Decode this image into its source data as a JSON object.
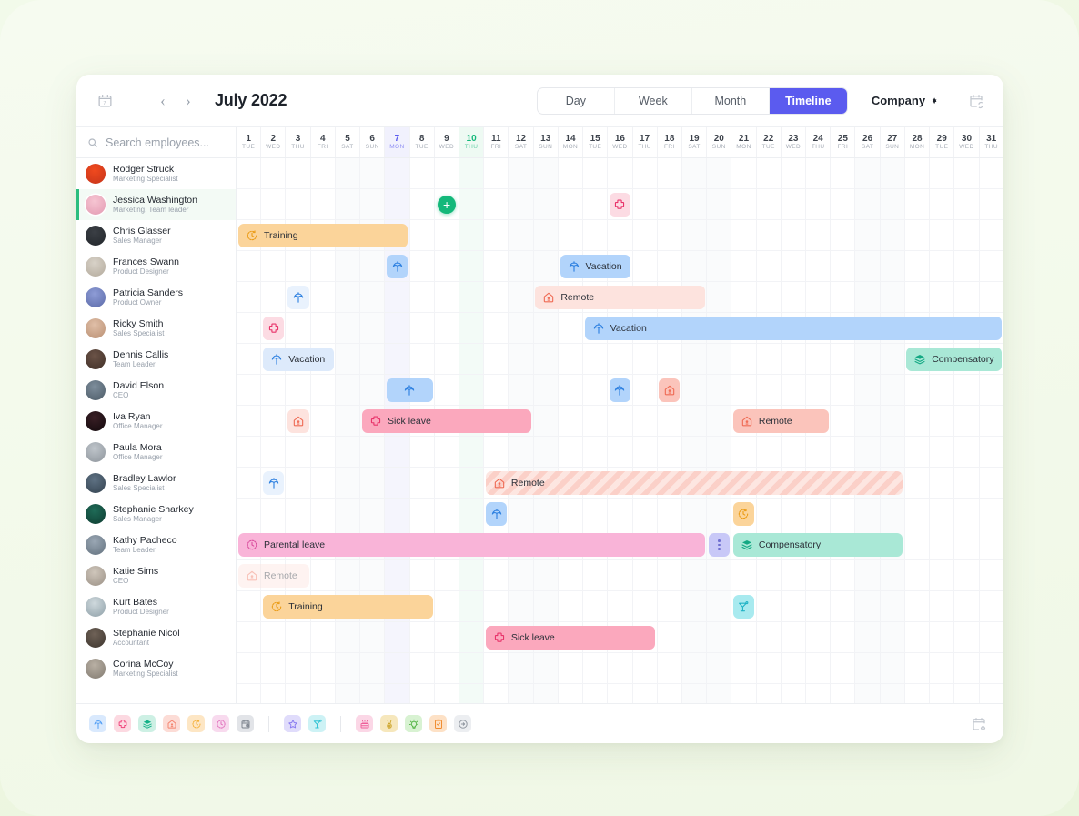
{
  "header": {
    "calendar_icon": "calendar-icon",
    "prev_label": "‹",
    "next_label": "›",
    "month_title": "July 2022",
    "view_tabs": [
      {
        "label": "Day",
        "active": false
      },
      {
        "label": "Week",
        "active": false
      },
      {
        "label": "Month",
        "active": false
      },
      {
        "label": "Timeline",
        "active": true
      }
    ],
    "company_label": "Company",
    "sync_icon": "calendar-sync-icon",
    "accent_color": "#5b5bef"
  },
  "search": {
    "placeholder": "Search employees...",
    "value": "",
    "icon": "search-icon"
  },
  "employees": [
    {
      "name": "Rodger Struck",
      "role": "Marketing Specialist",
      "selected": false,
      "avatar": [
        "#f04a1e",
        "#c6341a"
      ]
    },
    {
      "name": "Jessica Washington",
      "role": "Marketing, Team leader",
      "selected": true,
      "avatar": [
        "#f6c5d2",
        "#e39ab2"
      ]
    },
    {
      "name": "Chris Glasser",
      "role": "Sales Manager",
      "selected": false,
      "avatar": [
        "#3b3f45",
        "#22262b"
      ]
    },
    {
      "name": "Frances Swann",
      "role": "Product Designer",
      "selected": false,
      "avatar": [
        "#d8d2c8",
        "#b3aa9c"
      ]
    },
    {
      "name": "Patricia Sanders",
      "role": "Product Owner",
      "selected": false,
      "avatar": [
        "#8e9cd6",
        "#5b6aa8"
      ]
    },
    {
      "name": "Ricky Smith",
      "role": "Sales Specialist",
      "selected": false,
      "avatar": [
        "#e0bfa8",
        "#b98f72"
      ]
    },
    {
      "name": "Dennis Callis",
      "role": "Team Leader",
      "selected": false,
      "avatar": [
        "#6b5347",
        "#3f2f27"
      ]
    },
    {
      "name": "David Elson",
      "role": "CEO",
      "selected": false,
      "avatar": [
        "#7e8e9c",
        "#4b5a66"
      ]
    },
    {
      "name": "Iva Ryan",
      "role": "Office Manager",
      "selected": false,
      "avatar": [
        "#3a1f26",
        "#11090c"
      ]
    },
    {
      "name": "Paula Mora",
      "role": "Office Manager",
      "selected": false,
      "avatar": [
        "#bfc5cb",
        "#8d949b"
      ]
    },
    {
      "name": "Bradley Lawlor",
      "role": "Sales Specialist",
      "selected": false,
      "avatar": [
        "#5f7284",
        "#33424f"
      ]
    },
    {
      "name": "Stephanie Sharkey",
      "role": "Sales Manager",
      "selected": false,
      "avatar": [
        "#1f6b57",
        "#0e3c31"
      ]
    },
    {
      "name": "Kathy Pacheco",
      "role": "Team Leader",
      "selected": false,
      "avatar": [
        "#9aa7b4",
        "#63717e"
      ]
    },
    {
      "name": "Katie Sims",
      "role": "CEO",
      "selected": false,
      "avatar": [
        "#cfc6bb",
        "#9b9186"
      ]
    },
    {
      "name": "Kurt Bates",
      "role": "Product Designer",
      "selected": false,
      "avatar": [
        "#cfd9dd",
        "#8fa0a8"
      ]
    },
    {
      "name": "Stephanie Nicol",
      "role": "Accountant",
      "selected": false,
      "avatar": [
        "#6f6257",
        "#3c342d"
      ]
    },
    {
      "name": "Corina McCoy",
      "role": "Marketing Specialist",
      "selected": false,
      "avatar": [
        "#b9b0a4",
        "#817a70"
      ]
    }
  ],
  "days": [
    {
      "num": "1",
      "wd": "TUE",
      "weekend": false,
      "today": ""
    },
    {
      "num": "2",
      "wd": "WED",
      "weekend": false,
      "today": ""
    },
    {
      "num": "3",
      "wd": "THU",
      "weekend": false,
      "today": ""
    },
    {
      "num": "4",
      "wd": "FRI",
      "weekend": false,
      "today": ""
    },
    {
      "num": "5",
      "wd": "SAT",
      "weekend": true,
      "today": ""
    },
    {
      "num": "6",
      "wd": "SUN",
      "weekend": true,
      "today": ""
    },
    {
      "num": "7",
      "wd": "MON",
      "weekend": false,
      "today": "a"
    },
    {
      "num": "8",
      "wd": "TUE",
      "weekend": false,
      "today": ""
    },
    {
      "num": "9",
      "wd": "WED",
      "weekend": false,
      "today": ""
    },
    {
      "num": "10",
      "wd": "THU",
      "weekend": false,
      "today": "b"
    },
    {
      "num": "11",
      "wd": "FRI",
      "weekend": false,
      "today": ""
    },
    {
      "num": "12",
      "wd": "SAT",
      "weekend": true,
      "today": ""
    },
    {
      "num": "13",
      "wd": "SUN",
      "weekend": true,
      "today": ""
    },
    {
      "num": "14",
      "wd": "MON",
      "weekend": false,
      "today": ""
    },
    {
      "num": "15",
      "wd": "TUE",
      "weekend": false,
      "today": ""
    },
    {
      "num": "16",
      "wd": "WED",
      "weekend": false,
      "today": ""
    },
    {
      "num": "17",
      "wd": "THU",
      "weekend": false,
      "today": ""
    },
    {
      "num": "18",
      "wd": "FRI",
      "weekend": false,
      "today": ""
    },
    {
      "num": "19",
      "wd": "SAT",
      "weekend": true,
      "today": ""
    },
    {
      "num": "20",
      "wd": "SUN",
      "weekend": true,
      "today": ""
    },
    {
      "num": "21",
      "wd": "MON",
      "weekend": false,
      "today": ""
    },
    {
      "num": "22",
      "wd": "TUE",
      "weekend": false,
      "today": ""
    },
    {
      "num": "23",
      "wd": "WED",
      "weekend": false,
      "today": ""
    },
    {
      "num": "24",
      "wd": "THU",
      "weekend": false,
      "today": ""
    },
    {
      "num": "25",
      "wd": "FRI",
      "weekend": false,
      "today": ""
    },
    {
      "num": "26",
      "wd": "SAT",
      "weekend": true,
      "today": ""
    },
    {
      "num": "27",
      "wd": "SUN",
      "weekend": true,
      "today": ""
    },
    {
      "num": "28",
      "wd": "MON",
      "weekend": false,
      "today": ""
    },
    {
      "num": "29",
      "wd": "TUE",
      "weekend": false,
      "today": ""
    },
    {
      "num": "30",
      "wd": "WED",
      "weekend": false,
      "today": ""
    },
    {
      "num": "31",
      "wd": "THU",
      "weekend": false,
      "today": ""
    }
  ],
  "events": [
    {
      "row": 1,
      "start": 9,
      "end": 9,
      "label": "",
      "icon": "plus-icon",
      "style": "plus"
    },
    {
      "row": 1,
      "start": 16,
      "end": 16,
      "label": "",
      "icon": "sick-icon",
      "style": "c-sick-l"
    },
    {
      "row": 2,
      "start": 1,
      "end": 7,
      "label": "Training",
      "icon": "training-icon",
      "style": "c-train"
    },
    {
      "row": 3,
      "start": 7,
      "end": 7,
      "label": "",
      "icon": "vacation-icon",
      "style": "c-vac"
    },
    {
      "row": 3,
      "start": 14,
      "end": 16,
      "label": "Vacation",
      "icon": "vacation-icon",
      "style": "c-vac"
    },
    {
      "row": 4,
      "start": 3,
      "end": 3,
      "label": "",
      "icon": "vacation-icon",
      "style": "c-vac-xl"
    },
    {
      "row": 4,
      "start": 13,
      "end": 19,
      "label": "Remote",
      "icon": "remote-icon",
      "style": "c-rem-l"
    },
    {
      "row": 5,
      "start": 2,
      "end": 2,
      "label": "",
      "icon": "sick-icon",
      "style": "c-sick-l"
    },
    {
      "row": 5,
      "start": 15,
      "end": 31,
      "label": "Vacation",
      "icon": "vacation-icon",
      "style": "c-vac"
    },
    {
      "row": 6,
      "start": 2,
      "end": 4,
      "label": "Vacation",
      "icon": "vacation-icon",
      "style": "c-vac-l"
    },
    {
      "row": 6,
      "start": 28,
      "end": 31,
      "label": "Compensatory",
      "icon": "comp-icon",
      "style": "c-comp"
    },
    {
      "row": 7,
      "start": 7,
      "end": 8,
      "label": "",
      "icon": "vacation-icon",
      "style": "c-vac"
    },
    {
      "row": 7,
      "start": 16,
      "end": 16,
      "label": "",
      "icon": "vacation-icon",
      "style": "c-vac"
    },
    {
      "row": 7,
      "start": 18,
      "end": 18,
      "label": "",
      "icon": "remote-icon",
      "style": "c-rem"
    },
    {
      "row": 8,
      "start": 3,
      "end": 3,
      "label": "",
      "icon": "remote-icon",
      "style": "c-rem-l"
    },
    {
      "row": 8,
      "start": 6,
      "end": 12,
      "label": "Sick leave",
      "icon": "sick-icon",
      "style": "c-sick"
    },
    {
      "row": 8,
      "start": 21,
      "end": 24,
      "label": "Remote",
      "icon": "remote-icon",
      "style": "c-rem"
    },
    {
      "row": 10,
      "start": 2,
      "end": 2,
      "label": "",
      "icon": "vacation-icon",
      "style": "c-vac-xl"
    },
    {
      "row": 10,
      "start": 11,
      "end": 27,
      "label": "Remote",
      "icon": "remote-icon",
      "style": "c-rem-str"
    },
    {
      "row": 11,
      "start": 11,
      "end": 11,
      "label": "",
      "icon": "vacation-icon",
      "style": "c-vac"
    },
    {
      "row": 11,
      "start": 21,
      "end": 21,
      "label": "",
      "icon": "overtime-icon",
      "style": "c-overt"
    },
    {
      "row": 12,
      "start": 1,
      "end": 19,
      "label": "Parental leave",
      "icon": "parental-icon",
      "style": "c-par"
    },
    {
      "row": 12,
      "start": 20,
      "end": 20,
      "label": "",
      "icon": "more-icon",
      "style": "c-pend"
    },
    {
      "row": 12,
      "start": 21,
      "end": 27,
      "label": "Compensatory",
      "icon": "comp-icon",
      "style": "c-comp"
    },
    {
      "row": 13,
      "start": 1,
      "end": 3,
      "label": "Remote",
      "icon": "remote-icon",
      "style": "c-rem-l faded"
    },
    {
      "row": 14,
      "start": 2,
      "end": 8,
      "label": "Training",
      "icon": "training-icon",
      "style": "c-train"
    },
    {
      "row": 14,
      "start": 21,
      "end": 21,
      "label": "",
      "icon": "party-icon",
      "style": "c-party"
    },
    {
      "row": 15,
      "start": 11,
      "end": 17,
      "label": "Sick leave",
      "icon": "sick-icon",
      "style": "c-sick"
    }
  ],
  "footer": {
    "leave_types": [
      {
        "name": "vacation-icon",
        "bg": "#d9e9fd",
        "fg": "#4b9bf5"
      },
      {
        "name": "sick-icon",
        "bg": "#fcd9e1",
        "fg": "#f0407a"
      },
      {
        "name": "comp-icon",
        "bg": "#cdf0e4",
        "fg": "#13b187"
      },
      {
        "name": "remote-icon",
        "bg": "#fcdcd6",
        "fg": "#f4836e"
      },
      {
        "name": "training-icon",
        "bg": "#fde6c4",
        "fg": "#f5ae33"
      },
      {
        "name": "parental-icon",
        "bg": "#f8daee",
        "fg": "#e069b9"
      },
      {
        "name": "unpaid-icon",
        "bg": "#e2e4e8",
        "fg": "#7c838d"
      }
    ],
    "special_types": [
      {
        "name": "star-icon",
        "bg": "#e0dcfb",
        "fg": "#8a7bf0"
      },
      {
        "name": "cocktail-icon",
        "bg": "#cdf2f5",
        "fg": "#31c4d4"
      }
    ],
    "event_types": [
      {
        "name": "birthday-icon",
        "bg": "#fbd7e6",
        "fg": "#ef5f9a"
      },
      {
        "name": "award-icon",
        "bg": "#f6e7bc",
        "fg": "#cfa833"
      },
      {
        "name": "idea-icon",
        "bg": "#d8f2d2",
        "fg": "#52b343"
      },
      {
        "name": "onboarding-icon",
        "bg": "#fde1c6",
        "fg": "#f08a2c"
      },
      {
        "name": "login-icon",
        "bg": "#eceef1",
        "fg": "#8d949d"
      }
    ],
    "settings_icon": "calendar-settings-icon"
  }
}
